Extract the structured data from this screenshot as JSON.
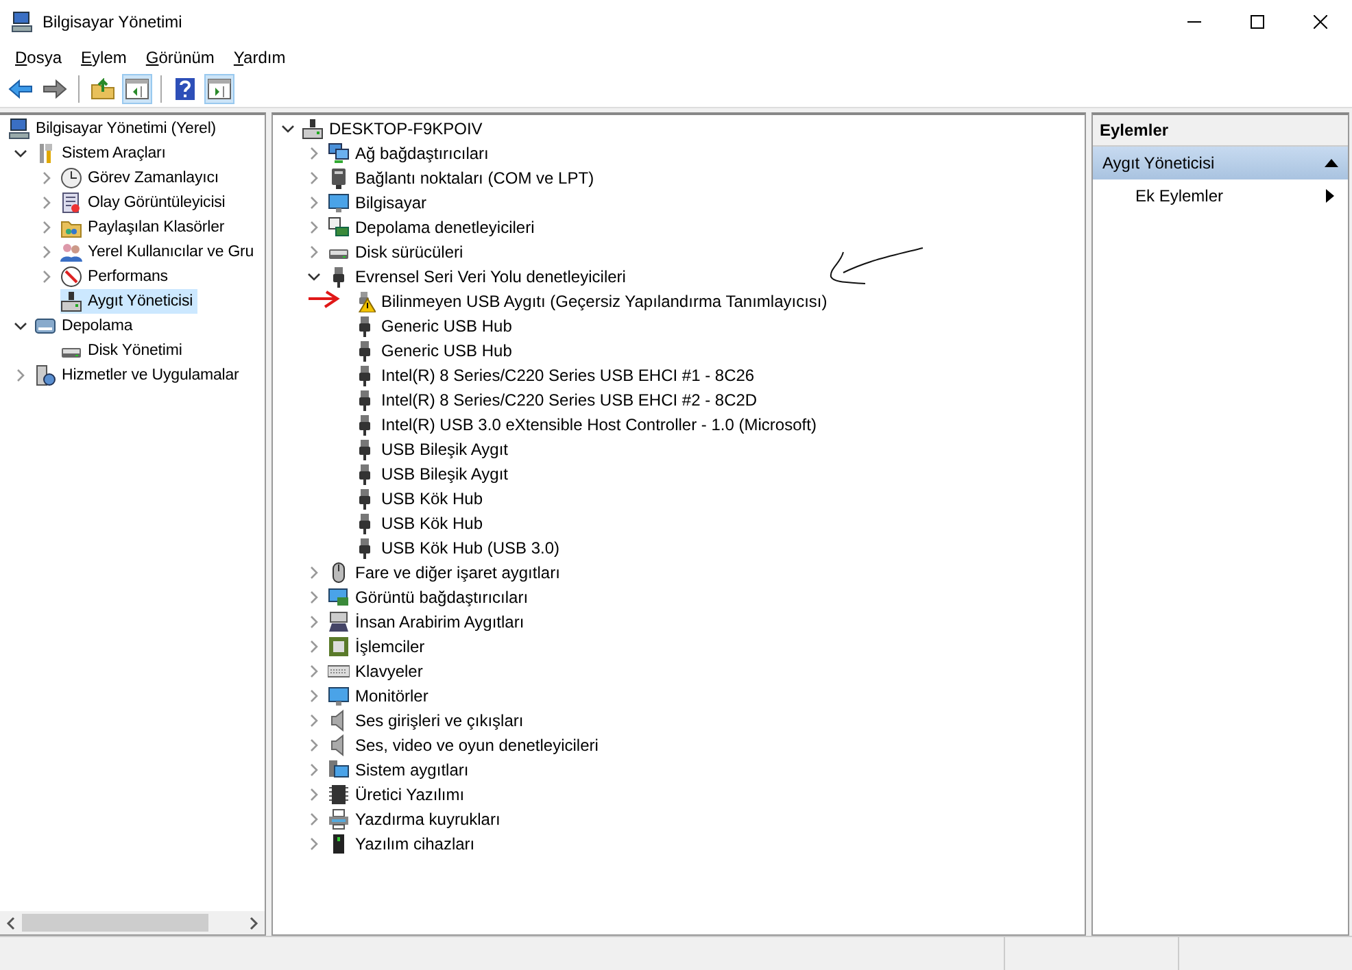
{
  "window": {
    "title": "Bilgisayar Yönetimi"
  },
  "menu": [
    "Dosya",
    "Eylem",
    "Görünüm",
    "Yardım"
  ],
  "toolbar": [
    {
      "pressed": false
    },
    {
      "pressed": false
    },
    {
      "pressed": false
    },
    {
      "pressed": true
    },
    {
      "pressed": false
    },
    {
      "pressed": true
    }
  ],
  "left_tree": [
    {
      "label": "Bilgisayar Yönetimi (Yerel)",
      "selected": false,
      "children": [
        {
          "label": "Sistem Araçları",
          "expanded": true,
          "selected": false,
          "children": [
            {
              "label": "Görev Zamanlayıcı",
              "expanded": false,
              "selected": false
            },
            {
              "label": "Olay Görüntüleyicisi",
              "expanded": false,
              "selected": false
            },
            {
              "label": "Paylaşılan Klasörler",
              "expanded": false,
              "selected": false
            },
            {
              "label": "Yerel Kullanıcılar ve Gru",
              "expanded": false,
              "selected": false
            },
            {
              "label": "Performans",
              "expanded": false,
              "selected": false
            },
            {
              "label": "Aygıt Yöneticisi",
              "selected": true
            }
          ]
        },
        {
          "label": "Depolama",
          "expanded": true,
          "selected": false,
          "children": [
            {
              "label": "Disk Yönetimi",
              "selected": false
            }
          ]
        },
        {
          "label": "Hizmetler ve Uygulamalar",
          "expanded": false,
          "selected": false
        }
      ]
    }
  ],
  "device_tree": [
    {
      "label": "DESKTOP-F9KPOIV",
      "expanded": true,
      "children": [
        {
          "label": "Ağ bağdaştırıcıları",
          "expanded": false
        },
        {
          "label": "Bağlantı noktaları (COM ve LPT)",
          "expanded": false
        },
        {
          "label": "Bilgisayar",
          "expanded": false
        },
        {
          "label": "Depolama denetleyicileri",
          "expanded": false
        },
        {
          "label": "Disk sürücüleri",
          "expanded": false
        },
        {
          "label": "Evrensel Seri Veri Yolu denetleyicileri",
          "expanded": true,
          "children": [
            {
              "label": "Bilinmeyen USB Aygıtı (Geçersiz Yapılandırma Tanımlayıcısı)",
              "warning": true
            },
            {
              "label": "Generic USB Hub",
              "warning": false
            },
            {
              "label": "Generic USB Hub",
              "warning": false
            },
            {
              "label": "Intel(R) 8 Series/C220 Series USB EHCI #1 - 8C26",
              "warning": false
            },
            {
              "label": "Intel(R) 8 Series/C220 Series USB EHCI #2 - 8C2D",
              "warning": false
            },
            {
              "label": "Intel(R) USB 3.0 eXtensible Host Controller - 1.0 (Microsoft)",
              "warning": false
            },
            {
              "label": "USB Bileşik Aygıt",
              "warning": false
            },
            {
              "label": "USB Bileşik Aygıt",
              "warning": false
            },
            {
              "label": "USB Kök Hub",
              "warning": false
            },
            {
              "label": "USB Kök Hub",
              "warning": false
            },
            {
              "label": "USB Kök Hub (USB 3.0)",
              "warning": false
            }
          ]
        },
        {
          "label": "Fare ve diğer işaret aygıtları",
          "expanded": false
        },
        {
          "label": "Görüntü bağdaştırıcıları",
          "expanded": false
        },
        {
          "label": "İnsan Arabirim Aygıtları",
          "expanded": false
        },
        {
          "label": "İşlemciler",
          "expanded": false
        },
        {
          "label": "Klavyeler",
          "expanded": false
        },
        {
          "label": "Monitörler",
          "expanded": false
        },
        {
          "label": "Ses girişleri ve çıkışları",
          "expanded": false
        },
        {
          "label": "Ses, video ve oyun denetleyicileri",
          "expanded": false
        },
        {
          "label": "Sistem aygıtları",
          "expanded": false
        },
        {
          "label": "Üretici Yazılımı",
          "expanded": false
        },
        {
          "label": "Yazdırma kuyrukları",
          "expanded": false
        },
        {
          "label": "Yazılım cihazları",
          "expanded": false
        }
      ]
    }
  ],
  "actions": {
    "header": "Eylemler",
    "section": {
      "label": "Aygıt Yöneticisi",
      "expanded": true
    },
    "items": [
      "Ek Eylemler"
    ]
  }
}
